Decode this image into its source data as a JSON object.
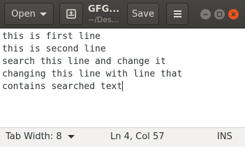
{
  "header": {
    "open_label": "Open",
    "title": "GFG...",
    "subtitle": "~/Des...",
    "save_label": "Save"
  },
  "editor": {
    "lines": [
      "this is first line",
      "this is second line",
      "search this line and change it",
      "changing this line with line that",
      "contains searched text"
    ]
  },
  "status": {
    "tab_width": "Tab Width: 8",
    "position": "Ln 4, Col 57",
    "mode": "INS"
  },
  "colors": {
    "headerbar": "#3c3b37",
    "close_button": "#e95420",
    "statusbar": "#f2f1f0"
  }
}
